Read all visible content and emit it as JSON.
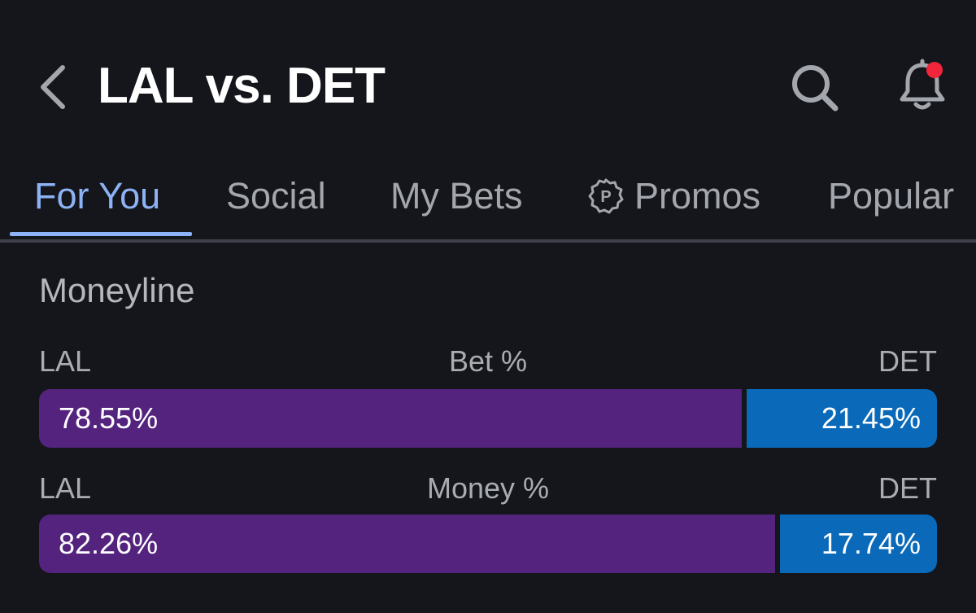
{
  "header": {
    "title": "LAL vs. DET",
    "back_icon": "chevron-left-icon",
    "search_icon": "search-icon",
    "bell_icon": "bell-icon",
    "notification_dot_color": "#f2253a"
  },
  "tabs": [
    {
      "label": "For You",
      "active": true
    },
    {
      "label": "Social",
      "active": false
    },
    {
      "label": "My Bets",
      "active": false
    },
    {
      "label": "Promos",
      "active": false,
      "icon": "promo-badge-icon"
    },
    {
      "label": "Popular",
      "active": false
    }
  ],
  "moneyline": {
    "title": "Moneyline",
    "stats": [
      {
        "left_team": "LAL",
        "metric": "Bet %",
        "right_team": "DET",
        "left_value": "78.55%",
        "right_value": "21.45%",
        "left_fraction": 0.7855
      },
      {
        "left_team": "LAL",
        "metric": "Money %",
        "right_team": "DET",
        "left_value": "82.26%",
        "right_value": "17.74%",
        "left_fraction": 0.8226
      }
    ]
  },
  "colors": {
    "background": "#14161b",
    "accent": "#8db3f6",
    "lal_bar": "#53237e",
    "det_bar": "#0a6ab9"
  }
}
